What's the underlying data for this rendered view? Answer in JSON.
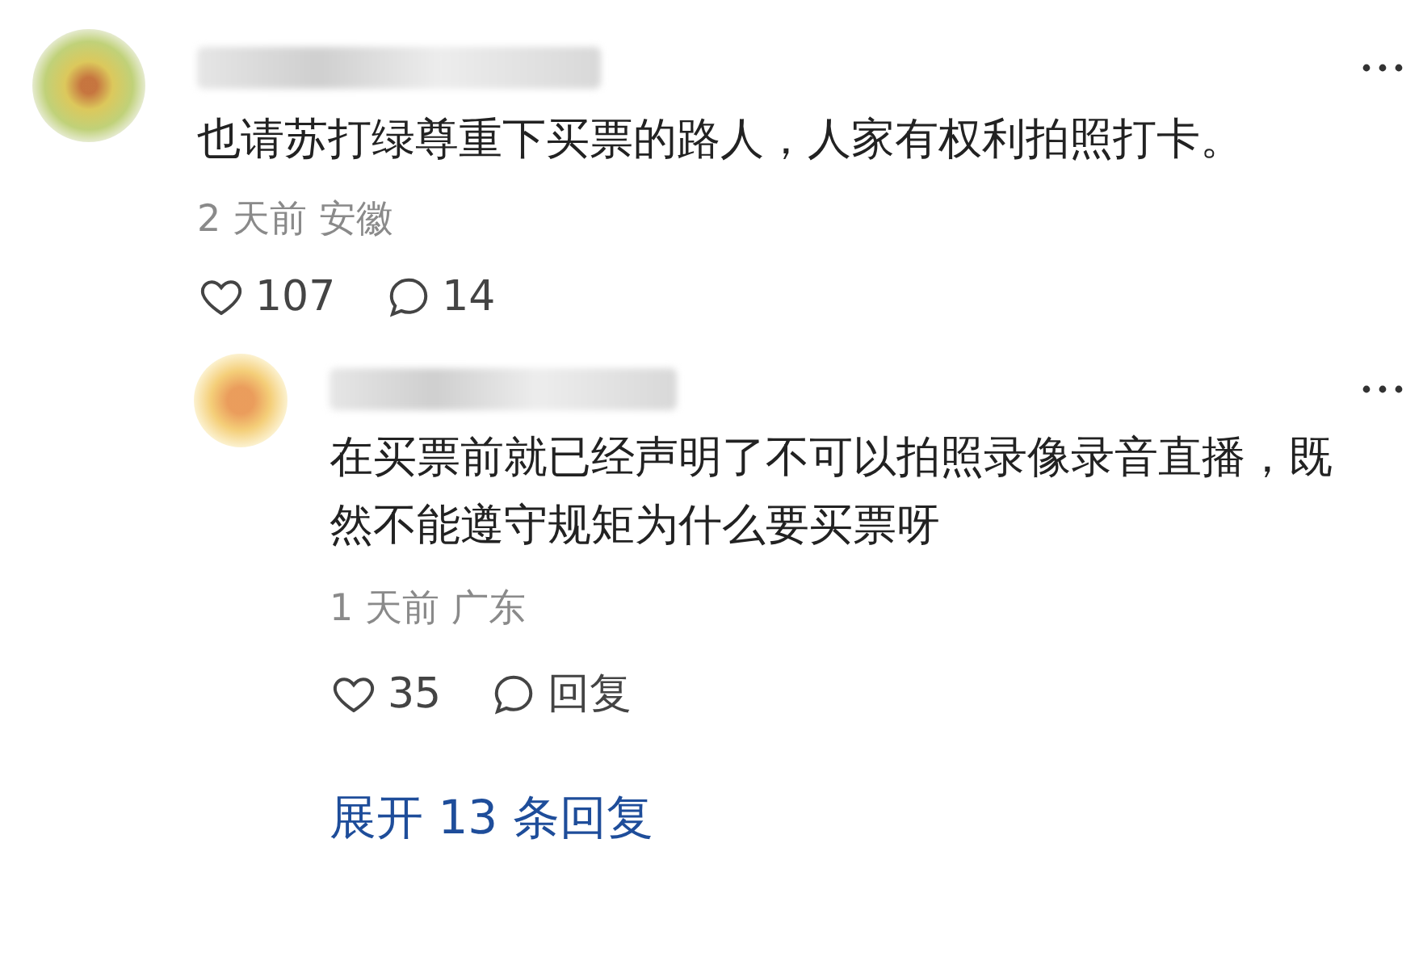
{
  "comment": {
    "text": "也请苏打绿尊重下买票的路人，人家有权利拍照打卡。",
    "time": "2 天前",
    "location": "安徽",
    "likes": "107",
    "replies": "14",
    "reply": {
      "text": "在买票前就已经声明了不可以拍照录像录音直播，既然不能遵守规矩为什么要买票呀",
      "time": "1 天前",
      "location": "广东",
      "likes": "35",
      "reply_label": "回复"
    },
    "expand_link": "展开 13 条回复"
  }
}
